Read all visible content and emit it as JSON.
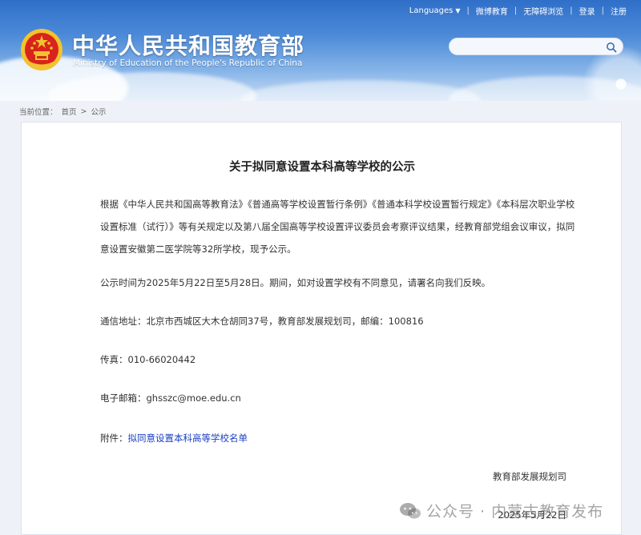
{
  "header": {
    "top_links": {
      "languages": "Languages",
      "weibo": "微博教育",
      "accessibility": "无障碍浏览",
      "login": "登录",
      "register": "注册"
    },
    "site_title": "中华人民共和国教育部",
    "site_subtitle": "Ministry of Education of the People's Republic of China",
    "search": {
      "placeholder": ""
    }
  },
  "breadcrumb": {
    "label": "当前位置：",
    "home": "首页",
    "current": "公示"
  },
  "article": {
    "title": "关于拟同意设置本科高等学校的公示",
    "paragraph1": "根据《中华人民共和国高等教育法》《普通高等学校设置暂行条例》《普通本科学校设置暂行规定》《本科层次职业学校设置标准（试行）》等有关规定以及第八届全国高等学校设置评议委员会考察评议结果，经教育部党组会议审议，拟同意设置安徽第二医学院等32所学校，现予公示。",
    "paragraph2": "公示时间为2025年5月22日至5月28日。期间，如对设置学校有不同意见，请署名向我们反映。",
    "address": "通信地址：北京市西城区大木仓胡同37号，教育部发展规划司，邮编：100816",
    "fax": "传真：010-66020442",
    "email": "电子邮箱：ghsszc@moe.edu.cn",
    "attachment_label": "附件：",
    "attachment_link": "拟同意设置本科高等学校名单",
    "signature_org": "教育部发展规划司",
    "signature_date": "2025年5月22日"
  },
  "watermark": {
    "text": "公众号 · 内蒙古教育发布"
  },
  "colors": {
    "header_blue": "#2f6fc8",
    "link_blue": "#1a3fc4",
    "emblem_red": "#d8241c",
    "emblem_gold": "#f2c230"
  }
}
